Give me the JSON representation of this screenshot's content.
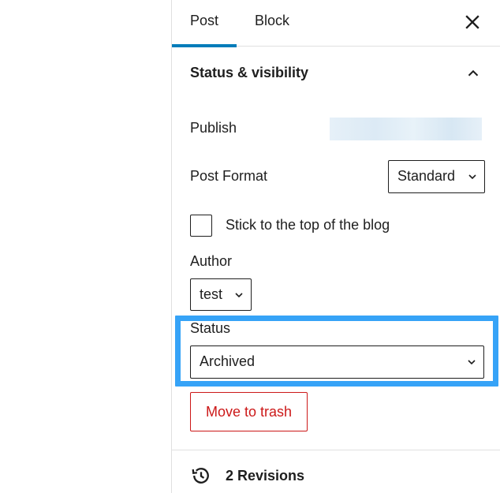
{
  "sidebar": {
    "tabs": [
      {
        "label": "Post",
        "active": true
      },
      {
        "label": "Block",
        "active": false
      }
    ],
    "close_icon": "close-icon",
    "accent_color": "#007cba"
  },
  "status_panel": {
    "title": "Status & visibility",
    "expanded": true,
    "publish": {
      "label": "Publish",
      "value": ""
    },
    "post_format": {
      "label": "Post Format",
      "selected": "Standard"
    },
    "sticky": {
      "label": "Stick to the top of the blog",
      "checked": false
    },
    "author": {
      "label": "Author",
      "selected": "test"
    },
    "status": {
      "label": "Status",
      "selected": "Archived",
      "highlight_color": "#36a3f7"
    },
    "trash": {
      "label": "Move to trash",
      "color": "#cc1818"
    }
  },
  "revisions": {
    "label": "2 Revisions",
    "icon": "history-icon"
  }
}
